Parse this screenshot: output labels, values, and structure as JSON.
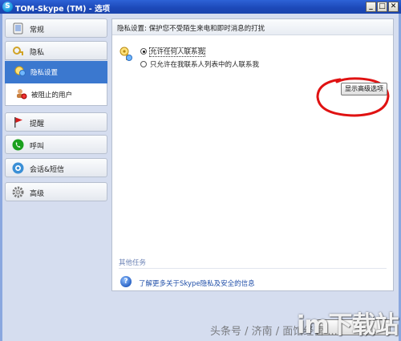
{
  "window": {
    "title": "TOM-Skype (TM) - 选项",
    "icon_letter": "S",
    "minimize_glyph": "_",
    "maximize_glyph": "□",
    "close_glyph": "✕"
  },
  "sidebar": {
    "items": [
      {
        "label": "常规",
        "icon": "skype-icon"
      },
      {
        "label": "隐私",
        "icon": "lock-icon"
      },
      {
        "label": "隐私设置",
        "icon": "privacy-settings-icon",
        "sub": true,
        "selected": true
      },
      {
        "label": "被阻止的用户",
        "icon": "blocked-users-icon",
        "sub": true
      },
      {
        "label": "提醒",
        "icon": "flag-icon"
      },
      {
        "label": "呼叫",
        "icon": "phone-icon"
      },
      {
        "label": "会话&短信",
        "icon": "chat-icon"
      },
      {
        "label": "高级",
        "icon": "gear-icon"
      }
    ]
  },
  "content": {
    "header": "隐私设置: 保护您不受陌生来电和即时消息的打扰",
    "radio_options": [
      {
        "label": "允许任何人联系我",
        "checked": true
      },
      {
        "label": "只允许在我联系人列表中的人联系我",
        "checked": false
      }
    ],
    "advanced_button": "显示高级选项",
    "other_tasks": "其他任务",
    "info_link": "了解更多关于Skype隐私及安全的信息"
  },
  "watermark": {
    "source": "头条号 / 济南 / 面馆经营 ...",
    "brand": "im下载站"
  }
}
